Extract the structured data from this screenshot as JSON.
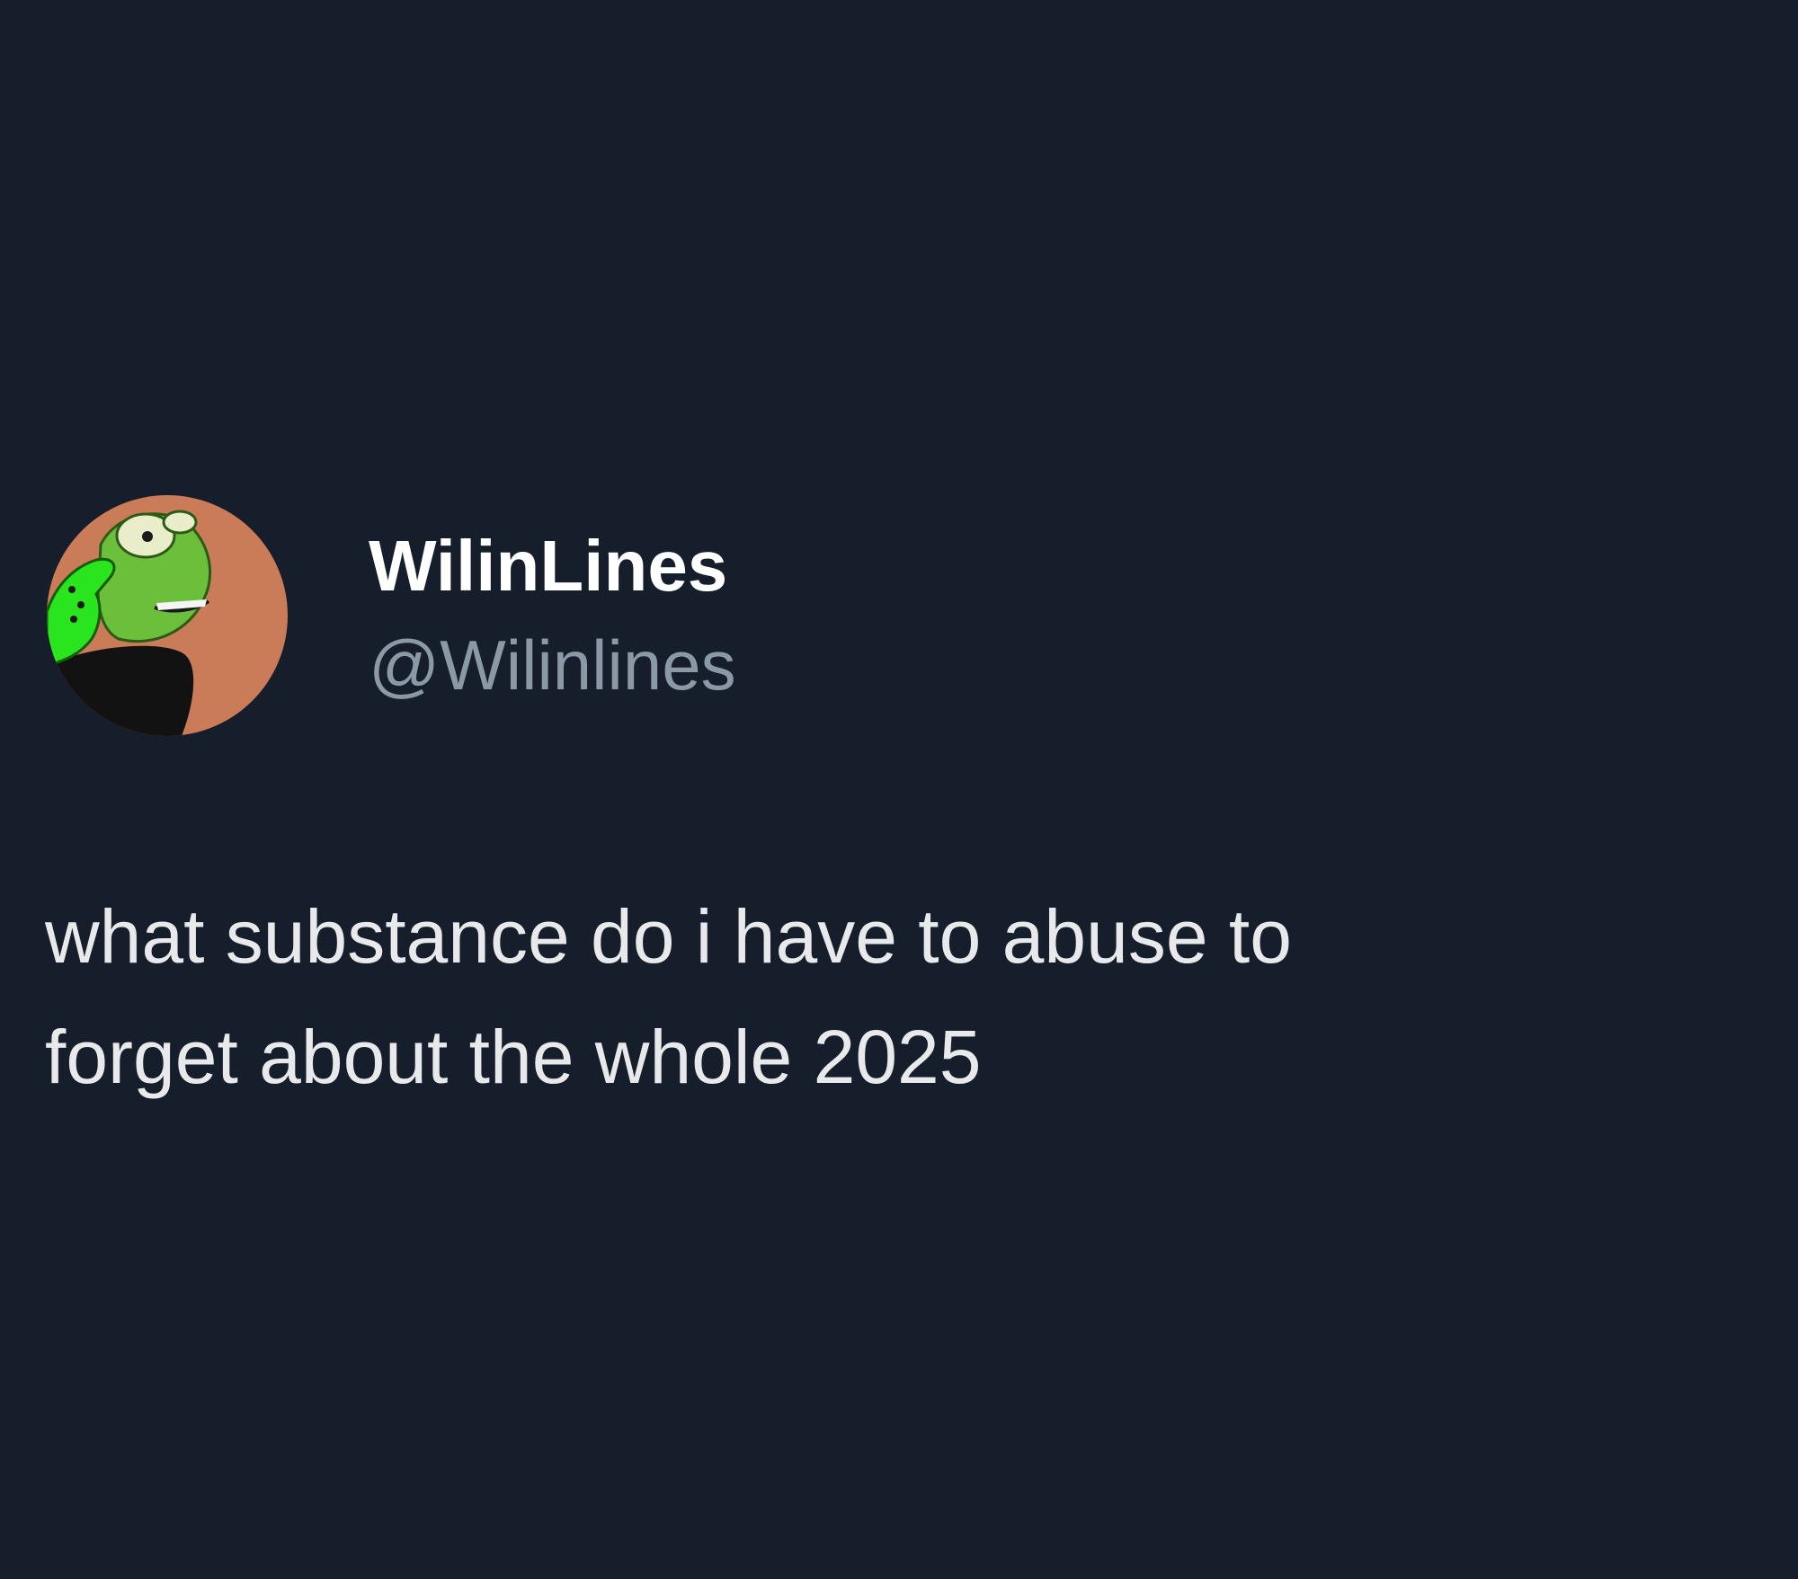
{
  "tweet": {
    "author": {
      "display_name": "WilinLines",
      "handle": "@Wilinlines",
      "avatar_icon": "kermit-frog-thinking-avatar"
    },
    "text": "what substance do i have to abuse to\nforget about the whole 2025"
  },
  "colors": {
    "background": "#151e2a",
    "display_name": "#ffffff",
    "handle": "#8b98a5",
    "body_text": "#e7e9ea",
    "avatar_background": "#c97c57"
  }
}
